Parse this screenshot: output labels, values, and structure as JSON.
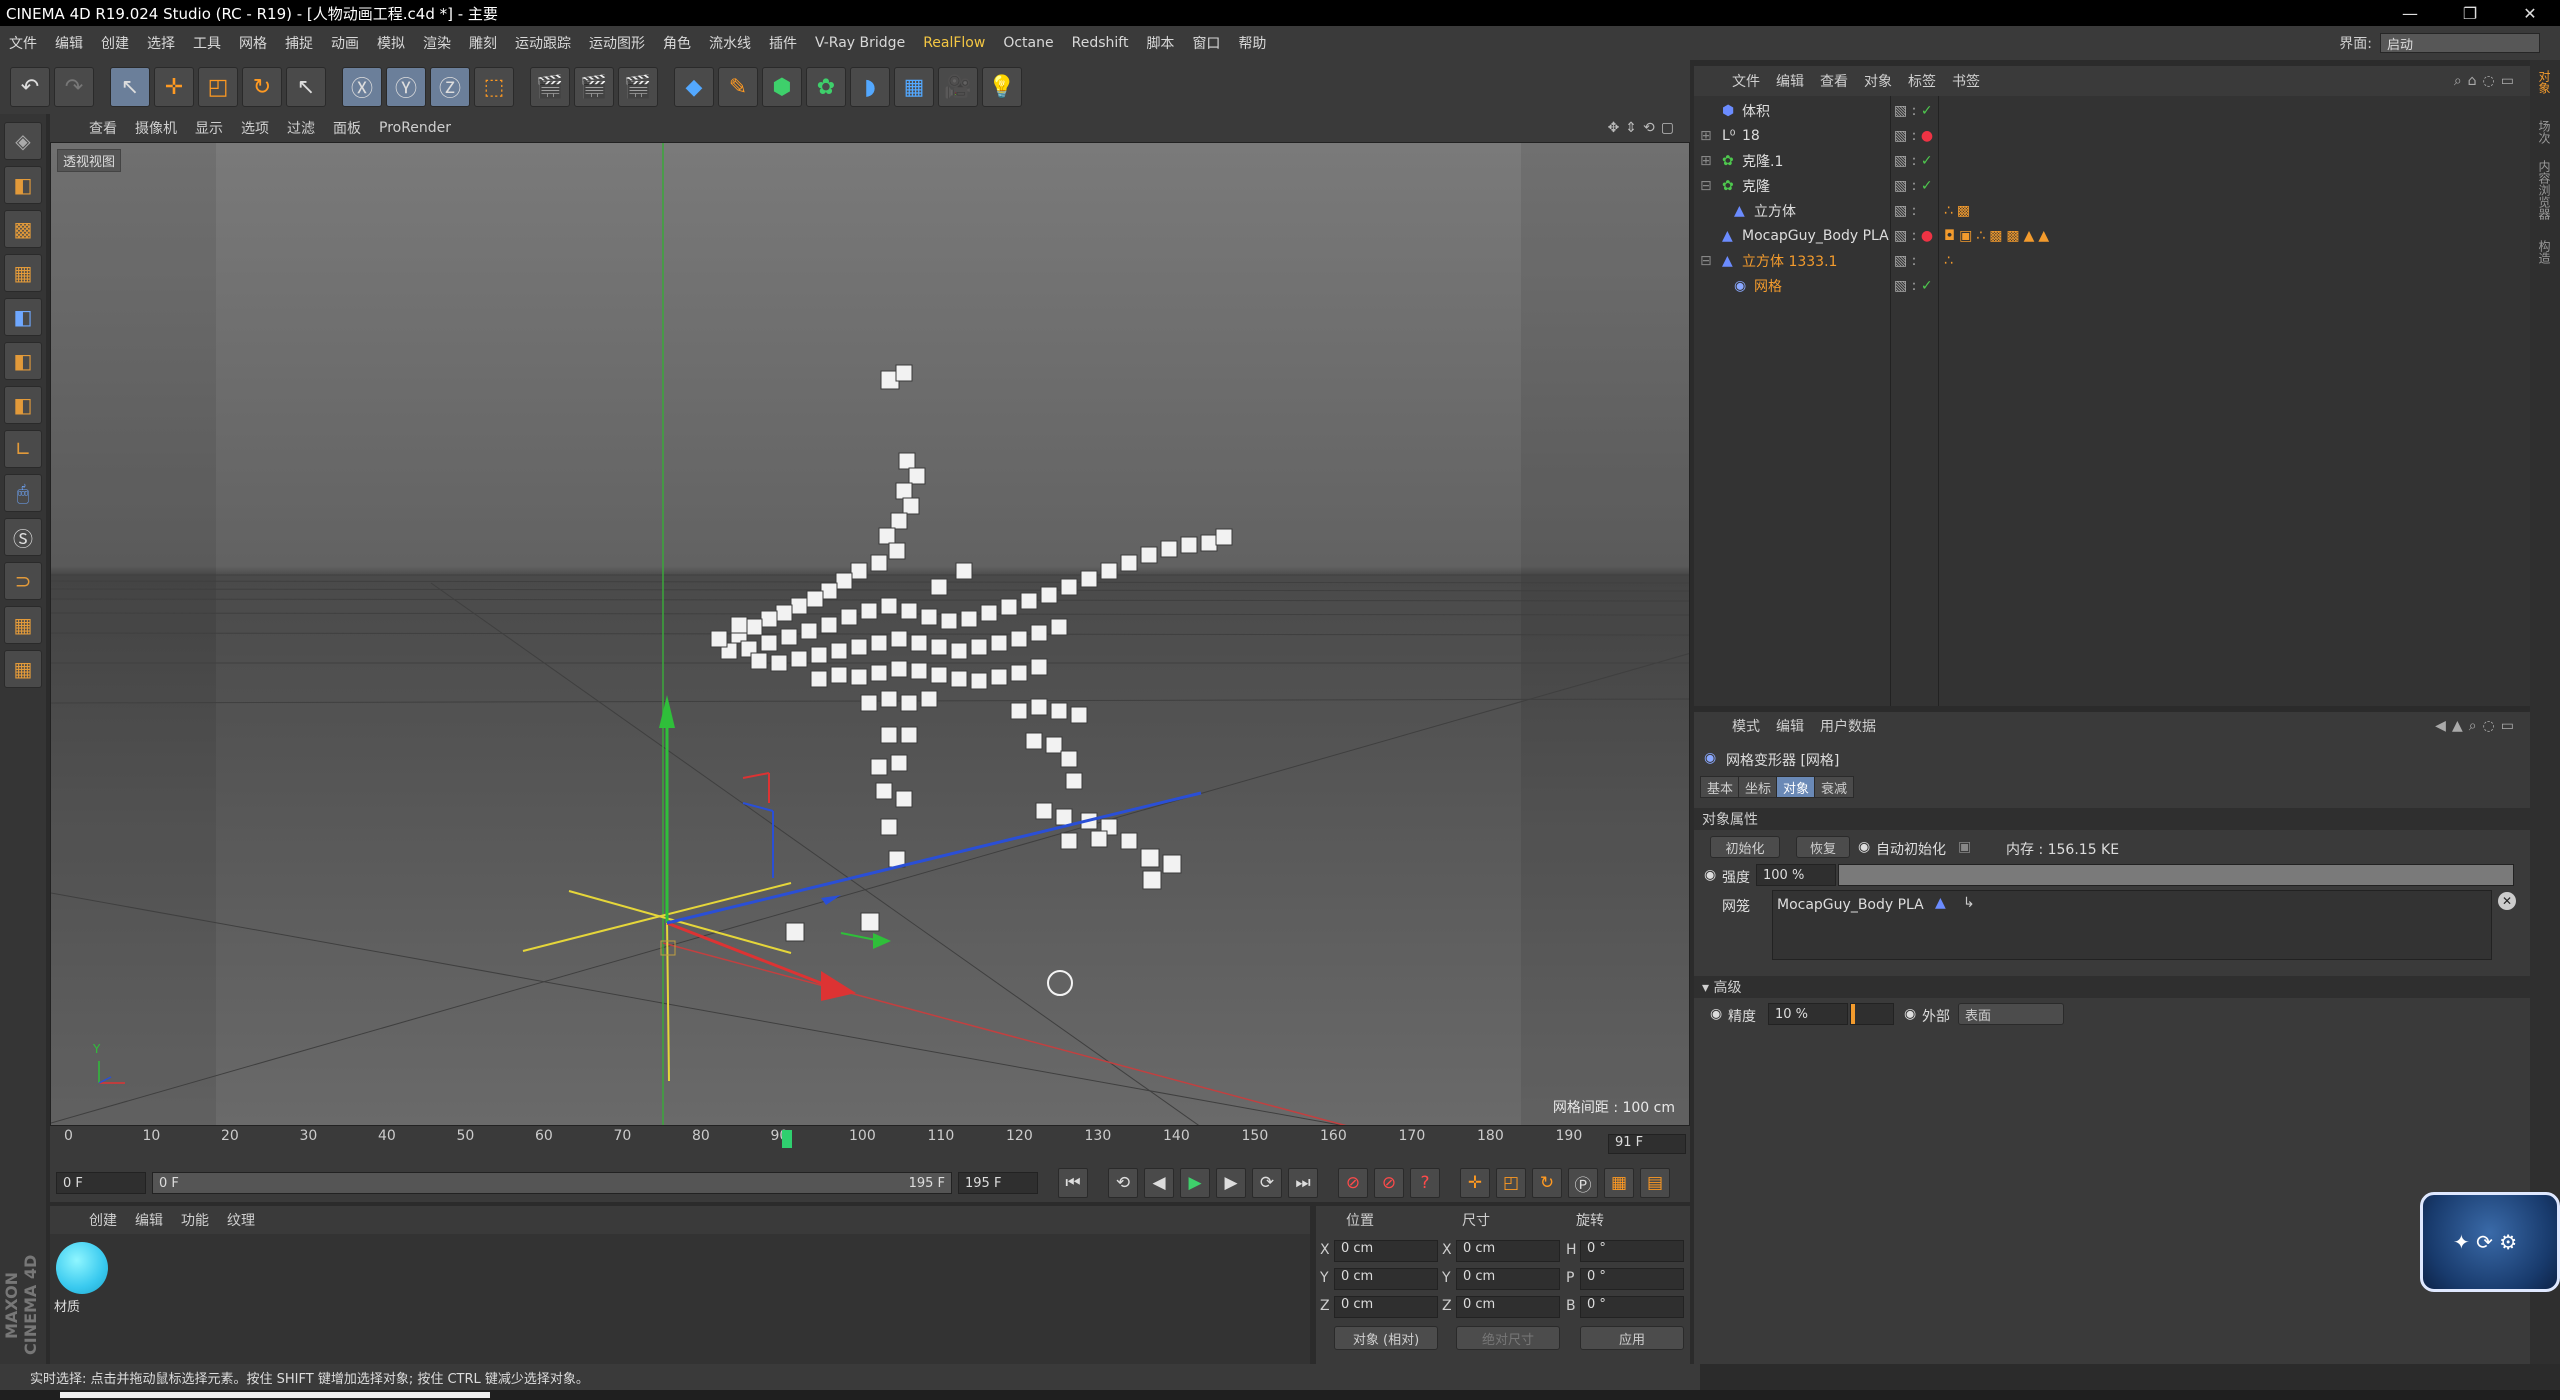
{
  "window": {
    "title": "CINEMA 4D R19.024 Studio (RC - R19) - [人物动画工程.c4d *] - 主要"
  },
  "menubar": {
    "items": [
      "文件",
      "编辑",
      "创建",
      "选择",
      "工具",
      "网格",
      "捕捉",
      "动画",
      "模拟",
      "渲染",
      "雕刻",
      "运动跟踪",
      "运动图形",
      "角色",
      "流水线",
      "插件",
      "V-Ray Bridge",
      "RealFlow",
      "Octane",
      "Redshift",
      "脚本",
      "窗口",
      "帮助"
    ],
    "layout_label": "界面:",
    "layout_value": "启动"
  },
  "viewport": {
    "menu": [
      "查看",
      "摄像机",
      "显示",
      "选项",
      "过滤",
      "面板",
      "ProRender"
    ],
    "label": "透视视图",
    "grid_spacing": "网格间距 : 100 cm"
  },
  "timeline": {
    "ticks": [
      "0",
      "10",
      "20",
      "30",
      "40",
      "50",
      "60",
      "70",
      "80",
      "90",
      "100",
      "110",
      "120",
      "130",
      "140",
      "150",
      "160",
      "170",
      "180",
      "190"
    ],
    "current_frame": "91 F",
    "playhead_frame": "91"
  },
  "transport": {
    "start": "0 F",
    "range_start": "0 F",
    "range_end": "195 F",
    "end": "195 F"
  },
  "material": {
    "menu": [
      "创建",
      "编辑",
      "功能",
      "纹理"
    ],
    "items": [
      {
        "name": "材质",
        "color": "#3ec8ee"
      }
    ]
  },
  "coords": {
    "headers": [
      "位置",
      "尺寸",
      "旋转"
    ],
    "rows": [
      {
        "a": "X",
        "pos": "0 cm",
        "b": "X",
        "size": "0 cm",
        "c": "H",
        "rot": "0 °"
      },
      {
        "a": "Y",
        "pos": "0 cm",
        "b": "Y",
        "size": "0 cm",
        "c": "P",
        "rot": "0 °"
      },
      {
        "a": "Z",
        "pos": "0 cm",
        "b": "Z",
        "size": "0 cm",
        "c": "B",
        "rot": "0 °"
      }
    ],
    "mode": "对象 (相对)",
    "size_mode": "绝对尺寸",
    "apply": "应用"
  },
  "status": "实时选择: 点击并拖动鼠标选择元素。按住 SHIFT 键增加选择对象; 按住 CTRL 键减少选择对象。",
  "object_manager": {
    "menu": [
      "文件",
      "编辑",
      "查看",
      "对象",
      "标签",
      "书签"
    ],
    "objects": [
      {
        "name": "体积",
        "orange": false
      },
      {
        "name": "18",
        "orange": false
      },
      {
        "name": "克隆.1",
        "orange": false
      },
      {
        "name": "克隆",
        "orange": false
      },
      {
        "name": "立方体",
        "orange": false
      },
      {
        "name": "MocapGuy_Body PLA",
        "orange": false
      },
      {
        "name": "立方体 1333.1",
        "orange": true
      },
      {
        "name": "网格",
        "orange": true
      }
    ]
  },
  "attributes": {
    "menu": [
      "模式",
      "编辑",
      "用户数据"
    ],
    "title": "网格变形器 [网格]",
    "tabs": [
      "基本",
      "坐标",
      "对象",
      "衰减"
    ],
    "active_tab": "对象",
    "section_object": "对象属性",
    "init_button": "初始化",
    "restore_button": "恢复",
    "auto_init": "自动初始化",
    "memory": "内存 : 156.15 KE",
    "strength_label": "强度",
    "strength_value": "100 %",
    "strength_fraction": 1.0,
    "mesh_label": "网笼",
    "mesh_value": "MocapGuy_Body PLA",
    "section_advanced": "▾ 高级",
    "precision_label": "精度",
    "precision_value": "10 %",
    "outside_label": "外部",
    "outside_value": "表面"
  },
  "right_strip": [
    "对象",
    "场次",
    "内容浏览器",
    "构造"
  ]
}
